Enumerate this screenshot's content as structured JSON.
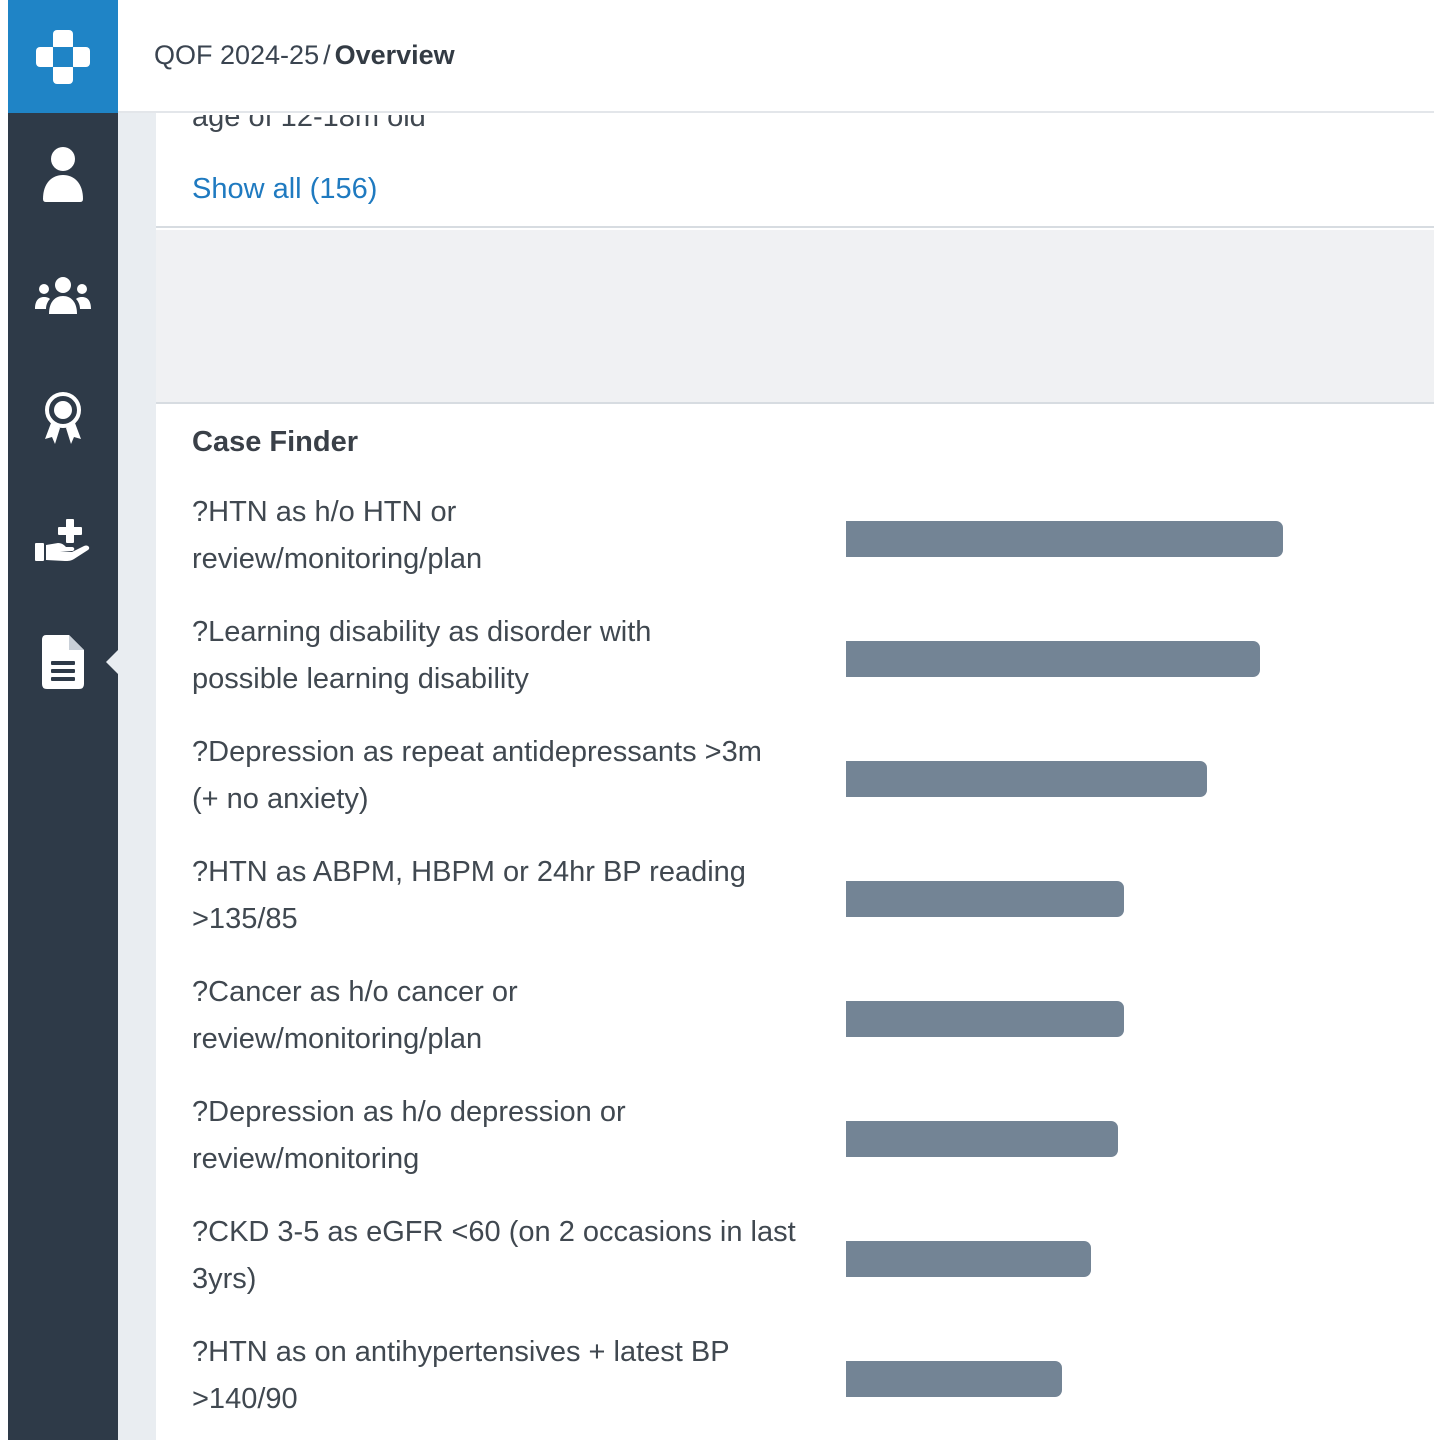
{
  "breadcrumb": {
    "parent": "QOF 2024-25",
    "separator": "/",
    "current": "Overview"
  },
  "sidebar": {
    "logo_icon": "medical-cross-logo-icon",
    "items": [
      {
        "icon": "user-icon",
        "active": false
      },
      {
        "icon": "users-group-icon",
        "active": false
      },
      {
        "icon": "award-ribbon-icon",
        "active": false
      },
      {
        "icon": "hand-medical-icon",
        "active": false
      },
      {
        "icon": "document-icon",
        "active": true
      }
    ],
    "colors": {
      "sidebar_bg": "#2e3a48",
      "logo_bg": "#1f84c6"
    }
  },
  "previous_section": {
    "cut_text": "age of 12-18m old",
    "show_all_label": "Show all (156)"
  },
  "case_finder": {
    "title": "Case Finder",
    "bar_color": "#738495",
    "rows": [
      {
        "line1": "?HTN as h/o HTN or",
        "line2": "review/monitoring/plan",
        "bar_fraction": 0.874
      },
      {
        "line1": "?Learning disability as disorder with",
        "line2": "possible learning disability",
        "bar_fraction": 0.828
      },
      {
        "line1": "?Depression as repeat antidepressants >3m",
        "line2": "(+ no anxiety)",
        "bar_fraction": 0.722
      },
      {
        "line1": "?HTN as ABPM, HBPM or 24hr BP reading",
        "line2": ">135/85",
        "bar_fraction": 0.556
      },
      {
        "line1": "?Cancer as h/o cancer or",
        "line2": "review/monitoring/plan",
        "bar_fraction": 0.556
      },
      {
        "line1": "?Depression as h/o depression or",
        "line2": "review/monitoring",
        "bar_fraction": 0.544
      },
      {
        "line1": "?CKD 3-5 as eGFR <60 (on 2 occasions in last",
        "line2": "3yrs)",
        "bar_fraction": 0.49
      },
      {
        "line1": "?HTN as on antihypertensives + latest BP",
        "line2": ">140/90",
        "bar_fraction": 0.432
      }
    ]
  }
}
